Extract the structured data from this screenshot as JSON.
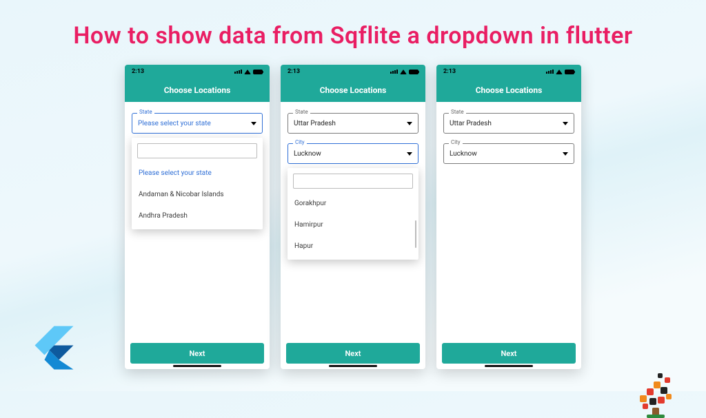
{
  "title": "How to show data from Sqflite a dropdown in flutter",
  "status_time": "2:13",
  "appbar_title": "Choose Locations",
  "next_label": "Next",
  "phones": [
    {
      "state": {
        "label": "State",
        "value": "Please select your state",
        "focused": true,
        "placeholder_style": "blue",
        "dropdown_open": true,
        "options": [
          {
            "text": "Please select your state",
            "selected": true
          },
          {
            "text": "Andaman & Nicobar Islands",
            "selected": false
          },
          {
            "text": "Andhra Pradesh",
            "selected": false
          }
        ]
      },
      "city": null
    },
    {
      "state": {
        "label": "State",
        "value": "Uttar Pradesh",
        "focused": false,
        "dropdown_open": false
      },
      "city": {
        "label": "City",
        "value": "Lucknow",
        "focused": true,
        "dropdown_open": true,
        "options": [
          {
            "text": "Gorakhpur",
            "selected": false
          },
          {
            "text": "Hamirpur",
            "selected": false
          },
          {
            "text": "Hapur",
            "selected": false
          }
        ]
      }
    },
    {
      "state": {
        "label": "State",
        "value": "Uttar Pradesh",
        "focused": false,
        "dropdown_open": false
      },
      "city": {
        "label": "City",
        "value": "Lucknow",
        "focused": false,
        "dropdown_open": false
      }
    }
  ]
}
